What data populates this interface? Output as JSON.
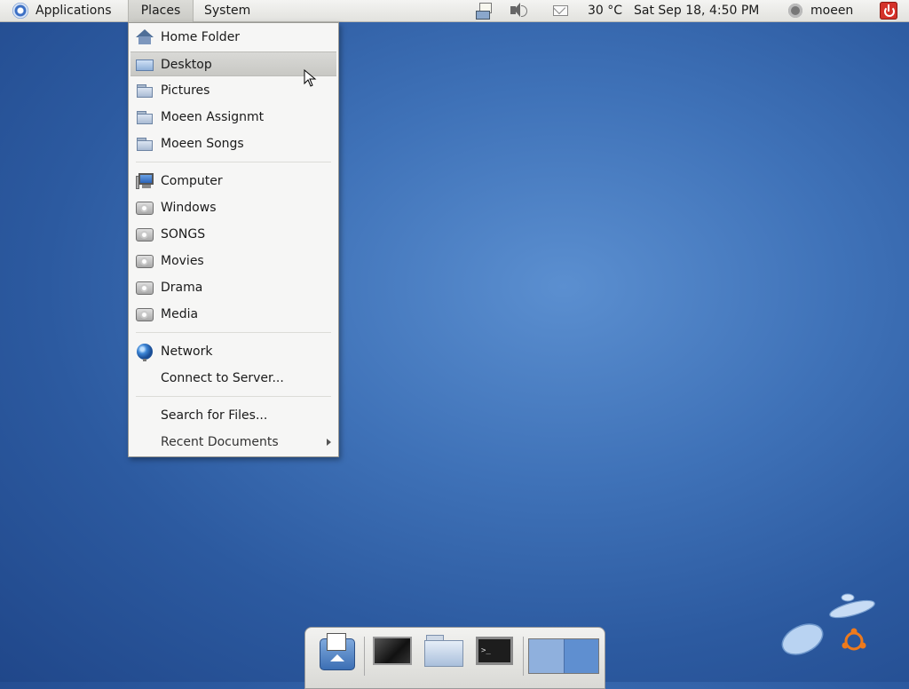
{
  "top_panel": {
    "applications_label": "Applications",
    "places_label": "Places",
    "system_label": "System",
    "temperature": "30 °C",
    "clock": "Sat Sep 18,  4:50 PM",
    "username": "moeen"
  },
  "places_menu": {
    "bookmarks": [
      {
        "label": "Home Folder",
        "icon": "home-icon"
      },
      {
        "label": "Desktop",
        "icon": "desktop-icon",
        "highlighted": true
      },
      {
        "label": "Pictures",
        "icon": "folder-icon"
      },
      {
        "label": "Moeen Assignmt",
        "icon": "folder-icon"
      },
      {
        "label": "Moeen Songs",
        "icon": "folder-icon"
      }
    ],
    "devices": [
      {
        "label": "Computer",
        "icon": "computer-icon"
      },
      {
        "label": "Windows",
        "icon": "drive-icon"
      },
      {
        "label": "SONGS",
        "icon": "drive-icon"
      },
      {
        "label": "Movies",
        "icon": "drive-icon"
      },
      {
        "label": "Drama",
        "icon": "drive-icon"
      },
      {
        "label": "Media",
        "icon": "drive-icon"
      }
    ],
    "network": [
      {
        "label": "Network",
        "icon": "network-icon"
      },
      {
        "label": "Connect to Server..."
      }
    ],
    "search": {
      "label": "Search for Files..."
    },
    "recent": {
      "label": "Recent Documents",
      "has_submenu": true
    }
  },
  "dock": {
    "apps": [
      "app-launcher-icon",
      "screen-app-icon",
      "file-browser-icon",
      "terminal-icon"
    ],
    "workspaces": 2
  },
  "colors": {
    "desktop_bg": "#3f72b8",
    "panel_bg": "#e8e8e4",
    "menu_highlight": "#cfcfcb"
  }
}
